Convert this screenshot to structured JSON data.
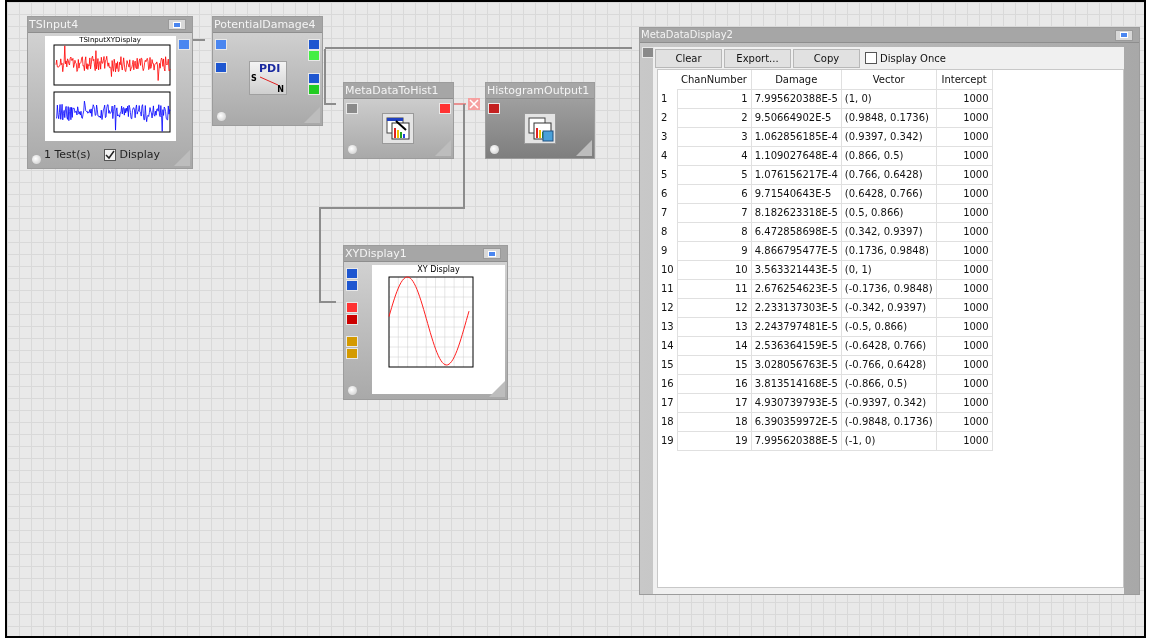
{
  "nodes": [
    {
      "kind": "input",
      "title": "TSInput4",
      "plot_title": "TSInputXYDisplay",
      "count": "1 Test(s)",
      "display": {
        "label": "Display",
        "checked": true
      },
      "outputs": [
        {
          "color": "#4a86f0"
        }
      ]
    },
    {
      "kind": "pdi",
      "title": "PotentialDamage4",
      "glyph": {
        "main": "PDI",
        "left": "S",
        "right": "N"
      },
      "inputs": [
        {
          "color": "#4a86f0"
        },
        {
          "color": "#1e56d0"
        }
      ],
      "outputs": [
        {
          "color": "#1e56d0"
        },
        {
          "color": "#44ee44"
        },
        {
          "color": "#1e56d0"
        },
        {
          "color": "#22cc22"
        }
      ]
    },
    {
      "kind": "hist",
      "title": "MetaDataToHist1",
      "inputs": [
        {
          "color": "#8a8a8a"
        }
      ],
      "outputs": [
        {
          "color": "#ff3333"
        }
      ]
    },
    {
      "kind": "histout",
      "title": "HistogramOutput1",
      "inputs": [
        {
          "color": "#c42020"
        }
      ]
    },
    {
      "kind": "xy",
      "title": "XYDisplay1",
      "plot_title": "XY Display",
      "inputs": [
        {
          "color": "#1e56d0"
        },
        {
          "color": "#1e56d0"
        },
        {
          "color": "#ff3333"
        },
        {
          "color": "#cc0000"
        },
        {
          "color": "#d49a00"
        },
        {
          "color": "#d49a00"
        }
      ]
    }
  ],
  "meta_display": {
    "title": "MetaDataDisplay2",
    "inputs": [
      {
        "color": "#8a8a8a"
      }
    ],
    "buttons": [
      "Clear",
      "Export...",
      "Copy"
    ],
    "display_once": {
      "label": "Display Once",
      "checked": false
    },
    "columns": [
      "",
      "ChanNumber",
      "Damage",
      "Vector",
      "Intercept"
    ],
    "rows": [
      [
        "1",
        "1",
        "7.995620388E-5",
        "(1, 0)",
        "1000"
      ],
      [
        "2",
        "2",
        "9.50664902E-5",
        "(0.9848, 0.1736)",
        "1000"
      ],
      [
        "3",
        "3",
        "1.062856185E-4",
        "(0.9397, 0.342)",
        "1000"
      ],
      [
        "4",
        "4",
        "1.109027648E-4",
        "(0.866, 0.5)",
        "1000"
      ],
      [
        "5",
        "5",
        "1.076156217E-4",
        "(0.766, 0.6428)",
        "1000"
      ],
      [
        "6",
        "6",
        "9.71540643E-5",
        "(0.6428, 0.766)",
        "1000"
      ],
      [
        "7",
        "7",
        "8.182623318E-5",
        "(0.5, 0.866)",
        "1000"
      ],
      [
        "8",
        "8",
        "6.472858698E-5",
        "(0.342, 0.9397)",
        "1000"
      ],
      [
        "9",
        "9",
        "4.866795477E-5",
        "(0.1736, 0.9848)",
        "1000"
      ],
      [
        "10",
        "10",
        "3.563321443E-5",
        "(0, 1)",
        "1000"
      ],
      [
        "11",
        "11",
        "2.676254623E-5",
        "(-0.1736, 0.9848)",
        "1000"
      ],
      [
        "12",
        "12",
        "2.233137303E-5",
        "(-0.342, 0.9397)",
        "1000"
      ],
      [
        "13",
        "13",
        "2.243797481E-5",
        "(-0.5, 0.866)",
        "1000"
      ],
      [
        "14",
        "14",
        "2.536364159E-5",
        "(-0.6428, 0.766)",
        "1000"
      ],
      [
        "15",
        "15",
        "3.028056763E-5",
        "(-0.766, 0.6428)",
        "1000"
      ],
      [
        "16",
        "16",
        "3.813514168E-5",
        "(-0.866, 0.5)",
        "1000"
      ],
      [
        "17",
        "17",
        "4.930739793E-5",
        "(-0.9397, 0.342)",
        "1000"
      ],
      [
        "18",
        "18",
        "6.390359972E-5",
        "(-0.9848, 0.1736)",
        "1000"
      ],
      [
        "19",
        "19",
        "7.995620388E-5",
        "(-1, 0)",
        "1000"
      ]
    ]
  }
}
